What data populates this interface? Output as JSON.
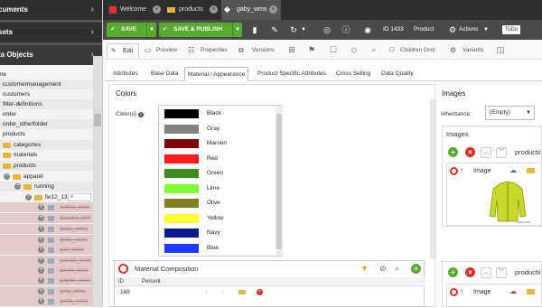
{
  "sidebar": {
    "documents_label": "cuments",
    "assets_label": "sets",
    "data_objects_label": "ta Objects",
    "tree": [
      {
        "label": "me",
        "kind": "root"
      },
      {
        "label": "customermanagement",
        "kind": "folder"
      },
      {
        "label": "customers",
        "kind": "folder"
      },
      {
        "label": "filter-definitions",
        "kind": "folder"
      },
      {
        "label": "order",
        "kind": "folder"
      },
      {
        "label": "order_otherfolder",
        "kind": "folder"
      },
      {
        "label": "products",
        "kind": "folder"
      },
      {
        "label": "categories",
        "kind": "folder"
      },
      {
        "label": "materials",
        "kind": "folder"
      },
      {
        "label": "products",
        "kind": "folder"
      },
      {
        "label": "apparel",
        "kind": "folder"
      },
      {
        "label": "running",
        "kind": "folder"
      },
      {
        "label": "fw12_13",
        "kind": "folder"
      },
      {
        "label": "cedric_men",
        "kind": "deleted"
      },
      {
        "label": "claudia_wm",
        "kind": "deleted"
      },
      {
        "label": "gaby_wms",
        "kind": "deleted"
      },
      {
        "label": "gaiia_wms",
        "kind": "deleted"
      },
      {
        "label": "gali_wms",
        "kind": "deleted"
      },
      {
        "label": "gareth_men",
        "kind": "deleted"
      },
      {
        "label": "gavin_men",
        "kind": "deleted"
      },
      {
        "label": "gaylor_men",
        "kind": "deleted"
      },
      {
        "label": "gely_wms",
        "kind": "deleted"
      },
      {
        "label": "gerla_wms",
        "kind": "deleted"
      }
    ]
  },
  "tabs": [
    {
      "label": "Welcome"
    },
    {
      "label": "products"
    },
    {
      "label": "gaby_wms"
    }
  ],
  "toolbar": {
    "save_label": "SAVE",
    "save_publish_label": "SAVE & PUBLISH",
    "id_label": "ID 1433",
    "class_label": "Product",
    "actions_label": "Actions",
    "todo_label": "ToDo"
  },
  "subbar": {
    "edit_label": "Edit",
    "preview_label": "Preview",
    "properties_label": "Properties",
    "versions_label": "Versions",
    "children_grid_label": "Children Grid",
    "variants_label": "Variants"
  },
  "main_tabs": [
    {
      "label": "Attributes"
    },
    {
      "label": "Base Data"
    },
    {
      "label": "Material / Appearance"
    },
    {
      "label": "Product Specific Attributes"
    },
    {
      "label": "Cross Selling"
    },
    {
      "label": "Data Quality"
    }
  ],
  "colors_panel": {
    "title": "Colors",
    "field_label": "Color(s)",
    "options": [
      {
        "name": "Black",
        "hex": "#000000"
      },
      {
        "name": "Gray",
        "hex": "#808080"
      },
      {
        "name": "Maroon",
        "hex": "#800000"
      },
      {
        "name": "Red",
        "hex": "#ff1a1a"
      },
      {
        "name": "Green",
        "hex": "#3f8a1f"
      },
      {
        "name": "Lime",
        "hex": "#7fff3a"
      },
      {
        "name": "Olive",
        "hex": "#808020"
      },
      {
        "name": "Yellow",
        "hex": "#ffff33"
      },
      {
        "name": "Navy",
        "hex": "#0a1a8a"
      },
      {
        "name": "Blue",
        "hex": "#1a3aff"
      }
    ]
  },
  "material_composition": {
    "title": "Material Composition",
    "columns": [
      "ID",
      "Percent"
    ],
    "rows": [
      {
        "id": "168"
      }
    ]
  },
  "images_panel": {
    "title": "Images",
    "inheritance_label": "Inheritance:",
    "inheritance_value": "(Empty)",
    "images_subtitle": "Images",
    "item_title": "productii",
    "image_label": "Image"
  },
  "colors": {
    "green": "#5aaa2f",
    "dark": "#2f2f2f",
    "red": "#d9302a"
  }
}
